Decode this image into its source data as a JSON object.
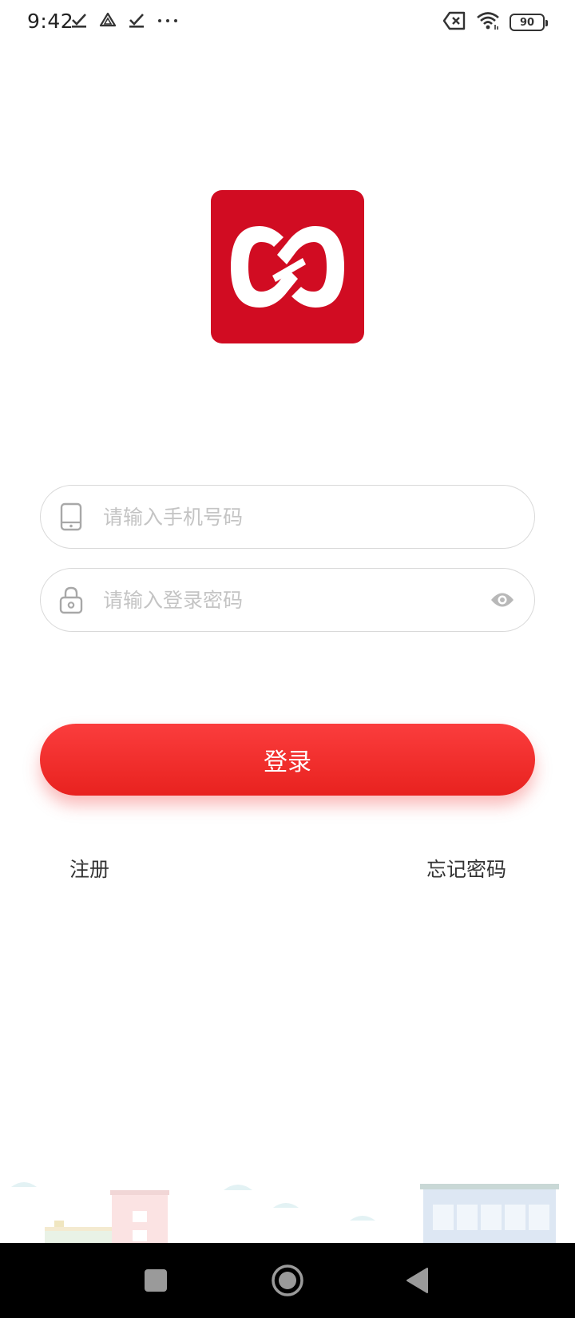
{
  "status_bar": {
    "time": "9:42",
    "left_icons": [
      "check-icon",
      "drive-icon",
      "check-icon",
      "more-dots-icon"
    ],
    "right_icons": [
      "no-sim-icon",
      "wifi-icon",
      "battery-icon"
    ],
    "battery_level": "90"
  },
  "logo": {
    "icon": "chain-link-logo",
    "background_color": "#d10c22"
  },
  "phone_input": {
    "placeholder": "请输入手机号码",
    "value": "",
    "icon": "phone-icon"
  },
  "password_input": {
    "placeholder": "请输入登录密码",
    "value": "",
    "icon": "lock-icon",
    "toggle_icon": "eye-icon"
  },
  "login_button": {
    "label": "登录"
  },
  "links": {
    "register": "注册",
    "forgot_password": "忘记密码"
  },
  "nav_bar": {
    "buttons": [
      "recents-button",
      "home-button",
      "back-button"
    ]
  }
}
